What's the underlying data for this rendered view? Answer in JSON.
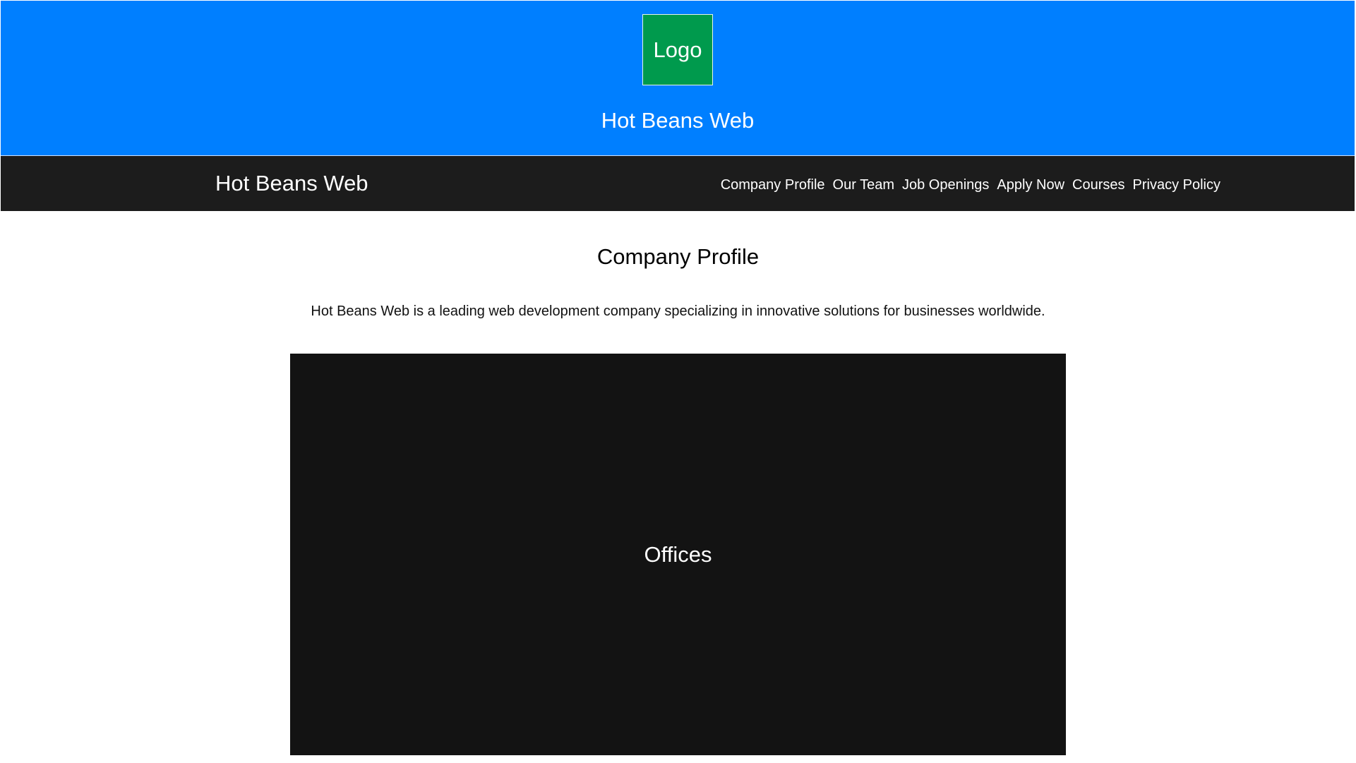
{
  "hero": {
    "logo_text": "Logo",
    "title": "Hot Beans Web"
  },
  "navbar": {
    "brand": "Hot Beans Web",
    "links": [
      {
        "label": "Company Profile"
      },
      {
        "label": "Our Team"
      },
      {
        "label": "Job Openings"
      },
      {
        "label": "Apply Now"
      },
      {
        "label": "Courses"
      },
      {
        "label": "Privacy Policy"
      }
    ]
  },
  "main": {
    "section_title": "Company Profile",
    "description": "Hot Beans Web is a leading web development company specializing in innovative solutions for businesses worldwide.",
    "media_label": "Offices"
  },
  "colors": {
    "hero_bg": "#007fff",
    "logo_bg": "#009a4d",
    "navbar_bg": "#1c1c1c",
    "media_bg": "#131313",
    "text_light": "#ffffff"
  }
}
